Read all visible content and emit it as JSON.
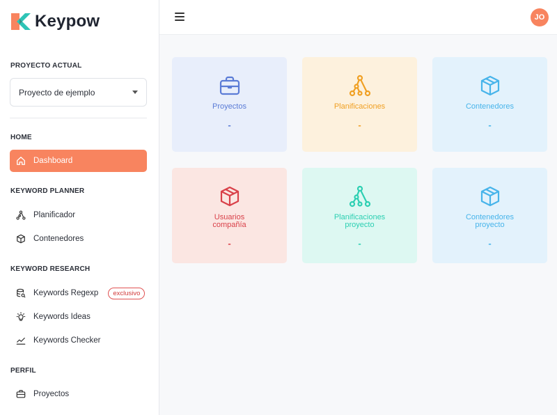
{
  "app": {
    "logo_text": "Keypow",
    "colors": {
      "accent": "#f8845f",
      "logo_orange": "#f8845f",
      "logo_teal": "#2ec4b6"
    }
  },
  "sidebar": {
    "project_section_label": "PROYECTO ACTUAL",
    "project_select_value": "Proyecto de ejemplo",
    "sections": [
      {
        "label": "HOME",
        "items": [
          {
            "label": "Dashboard",
            "icon": "home-icon",
            "active": true
          }
        ]
      },
      {
        "label": "KEYWORD PLANNER",
        "items": [
          {
            "label": "Planificador",
            "icon": "share-nodes-icon"
          },
          {
            "label": "Contenedores",
            "icon": "cube-icon"
          }
        ]
      },
      {
        "label": "KEYWORD RESEARCH",
        "items": [
          {
            "label": "Keywords Regexp",
            "icon": "database-search-icon",
            "badge": "exclusivo"
          },
          {
            "label": "Keywords Ideas",
            "icon": "lightbulb-icon"
          },
          {
            "label": "Keywords Checker",
            "icon": "chart-line-icon"
          }
        ]
      },
      {
        "label": "PERFIL",
        "items": [
          {
            "label": "Proyectos",
            "icon": "briefcase-icon"
          }
        ]
      }
    ]
  },
  "topbar": {
    "menu_icon": "hamburger-icon",
    "avatar_initials": "JO"
  },
  "cards": [
    {
      "title": "Proyectos",
      "value": "-",
      "icon": "briefcase-icon",
      "bg": "#e8eefb",
      "color": "#5a7bd6"
    },
    {
      "title": "Planificaciones",
      "value": "-",
      "icon": "share-nodes-icon",
      "bg": "#fdf1dd",
      "color": "#f0a023"
    },
    {
      "title": "Contenedores",
      "value": "-",
      "icon": "cube-icon",
      "bg": "#e3f2fc",
      "color": "#47b4ea"
    },
    {
      "title": "Usuarios compañía",
      "value": "-",
      "icon": "cube-icon",
      "bg": "#fbe6e2",
      "color": "#d94049"
    },
    {
      "title": "Planificaciones proyecto",
      "value": "-",
      "icon": "share-nodes-icon",
      "bg": "#ddf8f2",
      "color": "#2ccfb2"
    },
    {
      "title": "Contenedores proyecto",
      "value": "-",
      "icon": "cube-icon",
      "bg": "#e3f2fc",
      "color": "#47b4ea"
    }
  ]
}
